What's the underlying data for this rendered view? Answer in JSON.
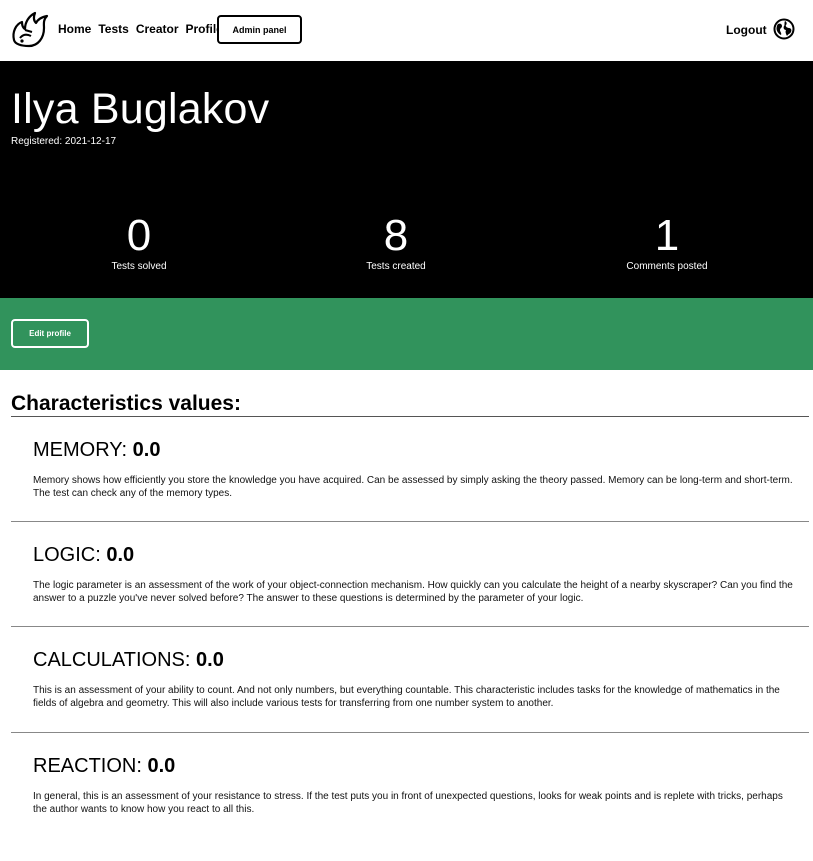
{
  "nav": {
    "items": [
      "Home",
      "Tests",
      "Creator",
      "Profile"
    ],
    "admin_label": "Admin panel",
    "logout_label": "Logout"
  },
  "profile": {
    "name": "Ilya Buglakov",
    "registered": "Registered: 2021-12-17",
    "stats": [
      {
        "value": "0",
        "label": "Tests solved"
      },
      {
        "value": "8",
        "label": "Tests created"
      },
      {
        "value": "1",
        "label": "Comments posted"
      }
    ],
    "edit_label": "Edit profile"
  },
  "characteristics": {
    "title": "Characteristics values:",
    "items": [
      {
        "name": "MEMORY:",
        "value": "0.0",
        "description": "Memory shows how efficiently you store the knowledge you have acquired. Can be assessed by simply asking the theory passed. Memory can be long-term and short-term. The test can check any of the memory types."
      },
      {
        "name": "LOGIC:",
        "value": "0.0",
        "description": "The logic parameter is an assessment of the work of your object-connection mechanism. How quickly can you calculate the height of a nearby skyscraper? Can you find the answer to a puzzle you've never solved before? The answer to these questions is determined by the parameter of your logic."
      },
      {
        "name": "CALCULATIONS:",
        "value": "0.0",
        "description": "This is an assessment of your ability to count. And not only numbers, but everything countable. This characteristic includes tasks for the knowledge of mathematics in the fields of algebra and geometry. This will also include various tests for transferring from one number system to another."
      },
      {
        "name": "REACTION:",
        "value": "0.0",
        "description": "In general, this is an assessment of your resistance to stress. If the test puts you in front of unexpected questions, looks for weak points and is replete with tricks, perhaps the author wants to know how you react to all this."
      }
    ]
  },
  "icons": {
    "logo": "flame-logo-icon",
    "language": "globe-icon"
  }
}
